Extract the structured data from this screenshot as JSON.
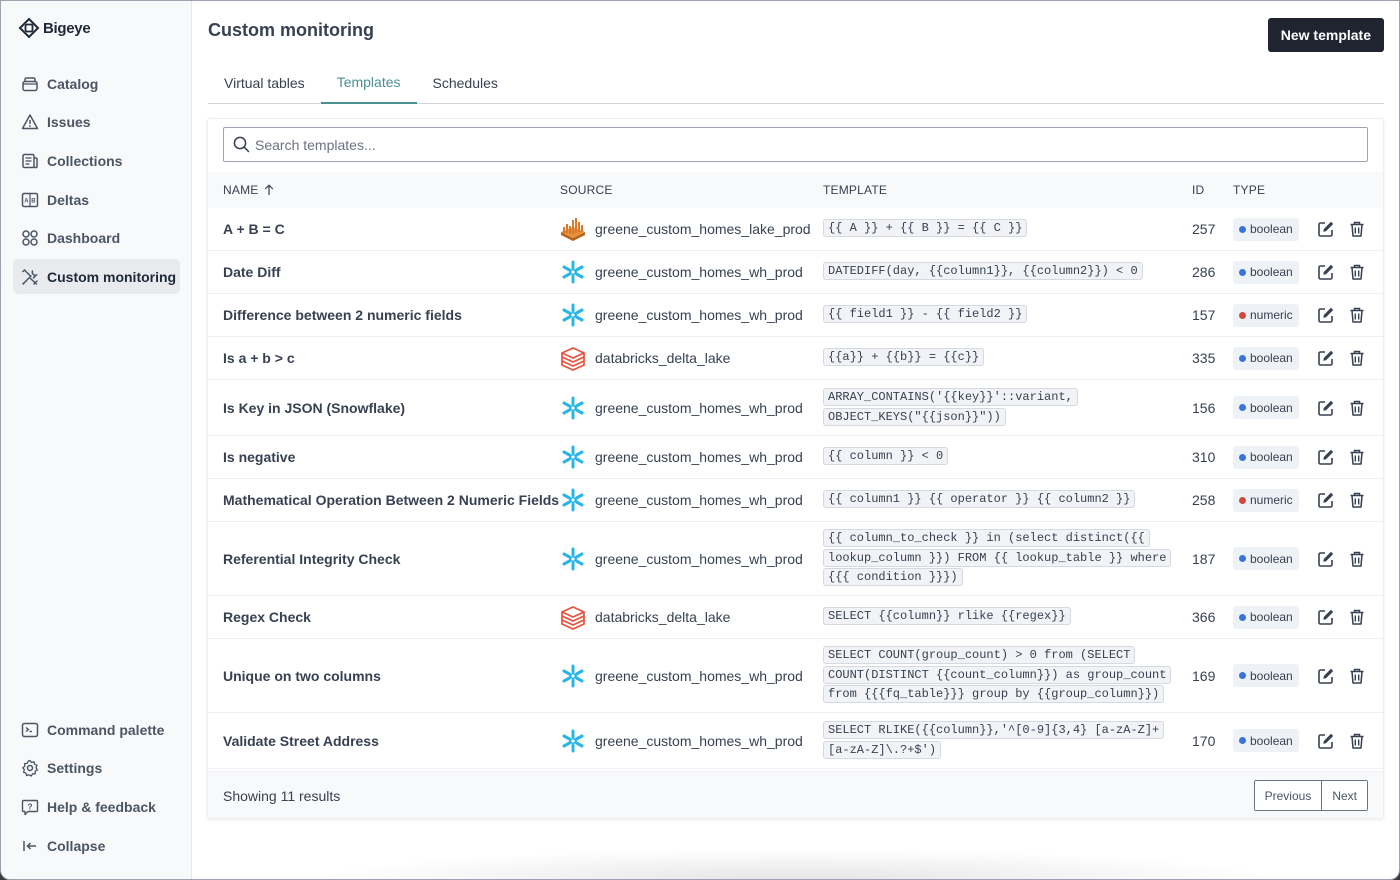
{
  "app": {
    "name": "Bigeye"
  },
  "sidebar": {
    "top_items": [
      {
        "label": "Catalog",
        "icon": "catalog-icon",
        "active": false
      },
      {
        "label": "Issues",
        "icon": "warning-triangle-icon",
        "active": false
      },
      {
        "label": "Collections",
        "icon": "collections-icon",
        "active": false
      },
      {
        "label": "Deltas",
        "icon": "deltas-icon",
        "active": false
      },
      {
        "label": "Dashboard",
        "icon": "dashboard-grid-icon",
        "active": false
      },
      {
        "label": "Custom monitoring",
        "icon": "tools-icon",
        "active": true
      }
    ],
    "bottom_items": [
      {
        "label": "Command palette",
        "icon": "terminal-icon"
      },
      {
        "label": "Settings",
        "icon": "gear-icon"
      },
      {
        "label": "Help & feedback",
        "icon": "help-bubble-icon"
      },
      {
        "label": "Collapse",
        "icon": "collapse-arrow-icon"
      }
    ]
  },
  "header": {
    "title": "Custom monitoring",
    "new_button": "New template"
  },
  "tabs": [
    {
      "label": "Virtual tables",
      "active": false
    },
    {
      "label": "Templates",
      "active": true
    },
    {
      "label": "Schedules",
      "active": false
    }
  ],
  "search": {
    "placeholder": "Search templates...",
    "value": ""
  },
  "table": {
    "columns": {
      "name": "NAME",
      "source": "SOURCE",
      "template": "TEMPLATE",
      "id": "ID",
      "type": "TYPE"
    },
    "sort": {
      "column": "name",
      "direction": "ascending"
    },
    "rows": [
      {
        "name": "A + B = C",
        "source": "greene_custom_homes_lake_prod",
        "source_type": "redshift",
        "template_lines": [
          "{{ A }} + {{ B }} = {{ C }}"
        ],
        "id": "257",
        "type": "boolean"
      },
      {
        "name": "Date Diff",
        "source": "greene_custom_homes_wh_prod",
        "source_type": "snowflake",
        "template_lines": [
          "DATEDIFF(day, {{column1}}, {{column2}}) < 0"
        ],
        "id": "286",
        "type": "boolean"
      },
      {
        "name": "Difference between 2 numeric fields",
        "source": "greene_custom_homes_wh_prod",
        "source_type": "snowflake",
        "template_lines": [
          "{{ field1 }} - {{ field2 }}"
        ],
        "id": "157",
        "type": "numeric"
      },
      {
        "name": "Is a + b > c",
        "source": "databricks_delta_lake",
        "source_type": "databricks",
        "template_lines": [
          "{{a}} + {{b}} = {{c}}"
        ],
        "id": "335",
        "type": "boolean"
      },
      {
        "name": "Is Key in JSON (Snowflake)",
        "source": "greene_custom_homes_wh_prod",
        "source_type": "snowflake",
        "template_lines": [
          "ARRAY_CONTAINS('{{key}}'::variant,",
          "OBJECT_KEYS(\"{{json}}\"))"
        ],
        "id": "156",
        "type": "boolean"
      },
      {
        "name": "Is negative",
        "source": "greene_custom_homes_wh_prod",
        "source_type": "snowflake",
        "template_lines": [
          "{{ column }} < 0"
        ],
        "id": "310",
        "type": "boolean"
      },
      {
        "name": "Mathematical Operation Between 2 Numeric Fields",
        "source": "greene_custom_homes_wh_prod",
        "source_type": "snowflake",
        "template_lines": [
          "{{ column1 }} {{ operator }} {{ column2 }}"
        ],
        "id": "258",
        "type": "numeric"
      },
      {
        "name": "Referential Integrity Check",
        "source": "greene_custom_homes_wh_prod",
        "source_type": "snowflake",
        "template_lines": [
          "{{ column_to_check }} in (select distinct({{",
          "lookup_column }}) FROM {{ lookup_table }} where",
          "{{{ condition }}})"
        ],
        "id": "187",
        "type": "boolean"
      },
      {
        "name": "Regex Check",
        "source": "databricks_delta_lake",
        "source_type": "databricks",
        "template_lines": [
          "SELECT {{column}} rlike {{regex}}"
        ],
        "id": "366",
        "type": "boolean"
      },
      {
        "name": "Unique on two columns",
        "source": "greene_custom_homes_wh_prod",
        "source_type": "snowflake",
        "template_lines": [
          "SELECT COUNT(group_count) > 0 from (SELECT",
          "COUNT(DISTINCT {{count_column}}) as group_count",
          "from {{{fq_table}}} group by {{group_column}})"
        ],
        "id": "169",
        "type": "boolean"
      },
      {
        "name": "Validate Street Address",
        "source": "greene_custom_homes_wh_prod",
        "source_type": "snowflake",
        "template_lines": [
          "SELECT RLIKE({{column}},'^[0-9]{3,4} [a-zA-Z]+",
          "[a-zA-Z]\\.?+$')"
        ],
        "id": "170",
        "type": "boolean"
      }
    ]
  },
  "type_colors": {
    "boolean": "#3b73d9",
    "numeric": "#d14b3a"
  },
  "footer": {
    "showing": "Showing 11 results",
    "previous": "Previous",
    "next": "Next"
  }
}
